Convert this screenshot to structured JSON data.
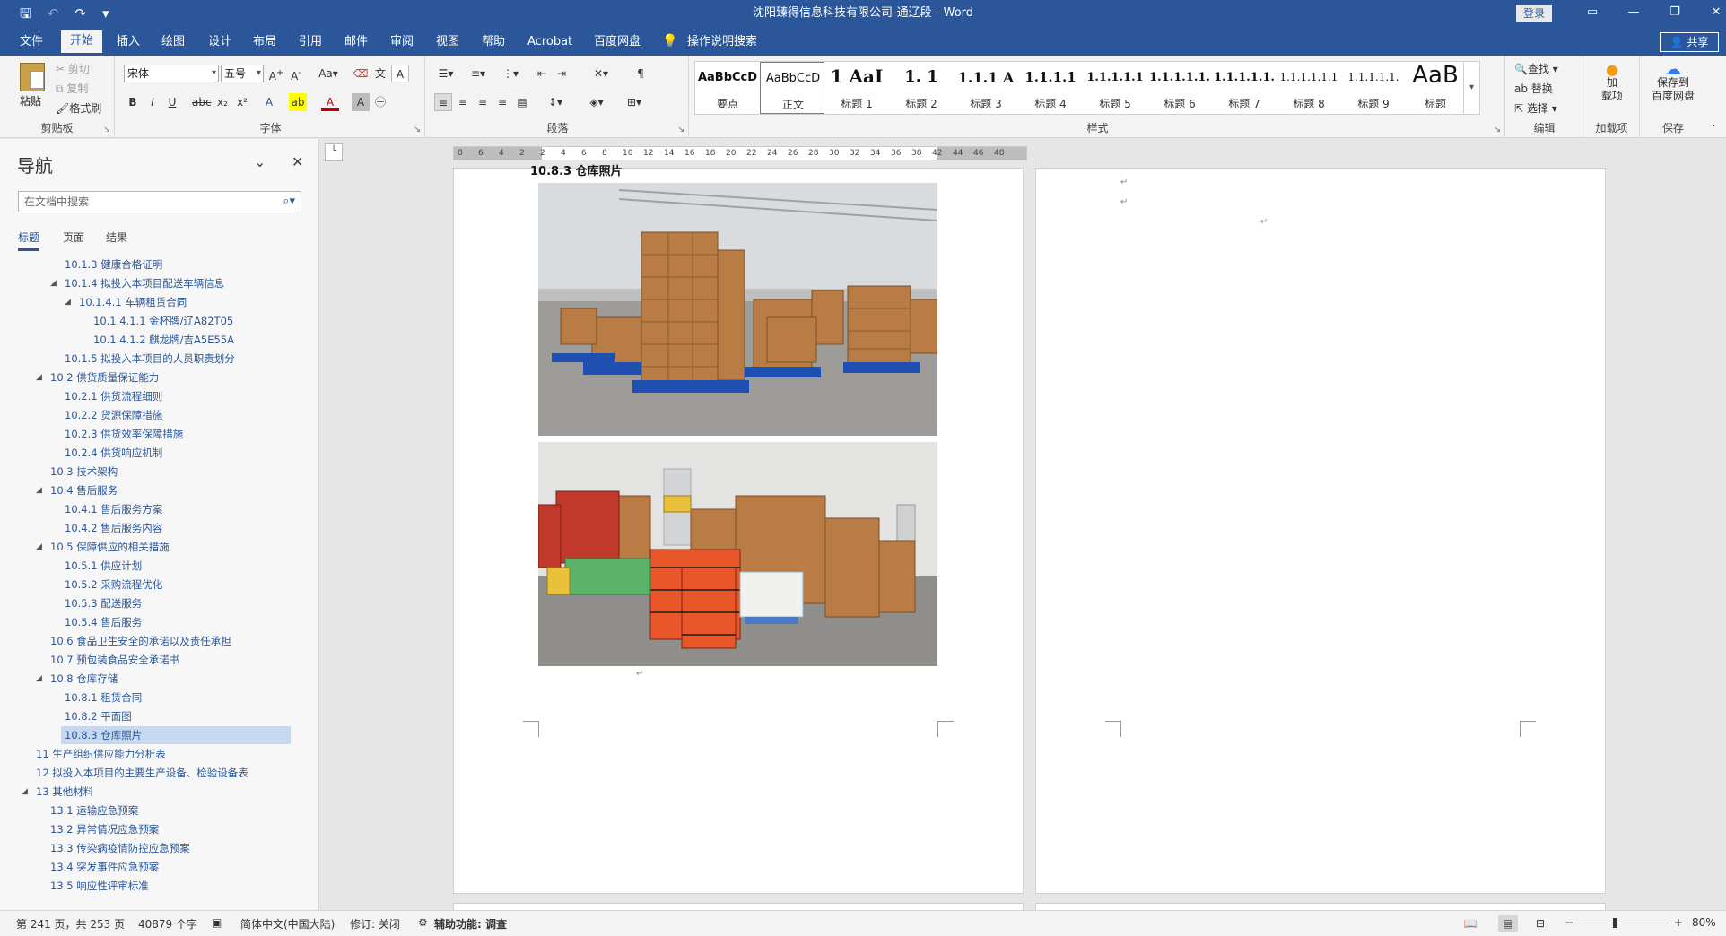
{
  "window": {
    "title": "沈阳臻得信息科技有限公司-通辽段  -  Word",
    "login_label": "登录",
    "save_icon": "save-icon",
    "window_buttons": [
      "▭",
      "—",
      "❐",
      "✕"
    ]
  },
  "quick_access": {
    "save": "🖫",
    "undo": "↶",
    "undo_more": "▾",
    "redo": "↷",
    "customize": "▾"
  },
  "menu_tabs": [
    "文件",
    "开始",
    "插入",
    "绘图",
    "设计",
    "布局",
    "引用",
    "邮件",
    "审阅",
    "视图",
    "帮助",
    "Acrobat",
    "百度网盘"
  ],
  "active_tab": "开始",
  "tell_me": "操作说明搜索",
  "share_label": "共享",
  "ribbon": {
    "clipboard": {
      "label": "剪贴板",
      "paste": "粘贴",
      "cut": "剪切",
      "copy": "复制",
      "format_painter": "格式刷"
    },
    "font": {
      "label": "字体",
      "font_name": "宋体",
      "font_size": "五号"
    },
    "paragraph": {
      "label": "段落"
    },
    "styles": {
      "label": "样式",
      "items": [
        {
          "preview": "AaBbCcD",
          "name": "要点"
        },
        {
          "preview": "AaBbCcD",
          "name": "正文"
        },
        {
          "preview": "1  AaI",
          "name": "标题 1"
        },
        {
          "preview": "1. 1",
          "name": "标题 2"
        },
        {
          "preview": "1.1.1  A",
          "name": "标题 3"
        },
        {
          "preview": "1.1.1.1",
          "name": "标题 4"
        },
        {
          "preview": "1.1.1.1.1",
          "name": "标题 5"
        },
        {
          "preview": "1.1.1.1.1.",
          "name": "标题 6"
        },
        {
          "preview": "1.1.1.1.1.",
          "name": "标题 7"
        },
        {
          "preview": "1.1.1.1.1.1",
          "name": "标题 8"
        },
        {
          "preview": "1.1.1.1.1.",
          "name": "标题 9"
        },
        {
          "preview": "AaB",
          "name": "标题"
        }
      ]
    },
    "editing": {
      "label": "编辑",
      "find": "查找",
      "replace": "替换",
      "select": "选择"
    },
    "addins": {
      "label": "加载项",
      "button": "加\n载项"
    },
    "save": {
      "label": "保存",
      "button": "保存到\n百度网盘"
    }
  },
  "navigation": {
    "title": "导航",
    "search_placeholder": "在文档中搜索",
    "tabs": [
      "标题",
      "页面",
      "结果"
    ],
    "outline": [
      {
        "text": "10.1.3 健康合格证明",
        "level": 3,
        "toggle": false
      },
      {
        "text": "10.1.4 拟投入本项目配送车辆信息",
        "level": 3,
        "toggle": true
      },
      {
        "text": "10.1.4.1 车辆租赁合同",
        "level": 4,
        "toggle": true
      },
      {
        "text": "10.1.4.1.1 金杯牌/辽A82T05",
        "level": 5,
        "toggle": false
      },
      {
        "text": "10.1.4.1.2 麒龙牌/吉A5E55A",
        "level": 5,
        "toggle": false
      },
      {
        "text": "10.1.5 拟投入本项目的人员职责划分",
        "level": 3,
        "toggle": false
      },
      {
        "text": "10.2 供货质量保证能力",
        "level": 2,
        "toggle": true
      },
      {
        "text": "10.2.1 供货流程细则",
        "level": 3,
        "toggle": false
      },
      {
        "text": "10.2.2 货源保障措施",
        "level": 3,
        "toggle": false
      },
      {
        "text": "10.2.3 供货效率保障措施",
        "level": 3,
        "toggle": false
      },
      {
        "text": "10.2.4 供货响应机制",
        "level": 3,
        "toggle": false
      },
      {
        "text": "10.3 技术架构",
        "level": 2,
        "toggle": false
      },
      {
        "text": "10.4 售后服务",
        "level": 2,
        "toggle": true
      },
      {
        "text": "10.4.1 售后服务方案",
        "level": 3,
        "toggle": false
      },
      {
        "text": "10.4.2 售后服务内容",
        "level": 3,
        "toggle": false
      },
      {
        "text": "10.5 保障供应的相关措施",
        "level": 2,
        "toggle": true
      },
      {
        "text": "10.5.1 供应计划",
        "level": 3,
        "toggle": false
      },
      {
        "text": "10.5.2 采购流程优化",
        "level": 3,
        "toggle": false
      },
      {
        "text": "10.5.3 配送服务",
        "level": 3,
        "toggle": false
      },
      {
        "text": "10.5.4 售后服务",
        "level": 3,
        "toggle": false
      },
      {
        "text": "10.6 食品卫生安全的承诺以及责任承担",
        "level": 2,
        "toggle": false
      },
      {
        "text": "10.7 预包装食品安全承诺书",
        "level": 2,
        "toggle": false
      },
      {
        "text": "10.8 仓库存储",
        "level": 2,
        "toggle": true
      },
      {
        "text": "10.8.1 租赁合同",
        "level": 3,
        "toggle": false
      },
      {
        "text": "10.8.2 平面图",
        "level": 3,
        "toggle": false
      },
      {
        "text": "10.8.3 仓库照片",
        "level": 3,
        "toggle": false,
        "selected": true
      },
      {
        "text": "11 生产组织供应能力分析表",
        "level": 1,
        "toggle": false
      },
      {
        "text": "12 拟投入本项目的主要生产设备、检验设备表",
        "level": 1,
        "toggle": false
      },
      {
        "text": "13 其他材料",
        "level": 1,
        "toggle": true
      },
      {
        "text": "13.1 运输应急预案",
        "level": 2,
        "toggle": false
      },
      {
        "text": "13.2 异常情况应急预案",
        "level": 2,
        "toggle": false
      },
      {
        "text": "13.3 传染病疫情防控应急预案",
        "level": 2,
        "toggle": false
      },
      {
        "text": "13.4 突发事件应急预案",
        "level": 2,
        "toggle": false
      },
      {
        "text": "13.5 响应性评审标准",
        "level": 2,
        "toggle": false
      }
    ]
  },
  "ruler": {
    "ticks": [
      "8",
      "6",
      "4",
      "2",
      "2",
      "4",
      "6",
      "8",
      "10",
      "12",
      "14",
      "16",
      "18",
      "20",
      "22",
      "24",
      "26",
      "28",
      "30",
      "32",
      "34",
      "36",
      "38",
      "42",
      "44",
      "46",
      "48"
    ]
  },
  "document": {
    "heading_fragment": "10.8.3 仓库照片",
    "paragraph_mark": "↵"
  },
  "status": {
    "page": "第 241 页，共 253 页",
    "words": "40879 个字",
    "language": "简体中文(中国大陆)",
    "track_changes": "修订: 关闭",
    "accessibility": "辅助功能: 调查",
    "zoom": "80%",
    "zoom_minus": "−",
    "zoom_plus": "+"
  },
  "colors": {
    "brand": "#2b579a",
    "ribbon_bg": "#f3f3f3",
    "selected_nav": "#c6d7f0"
  }
}
